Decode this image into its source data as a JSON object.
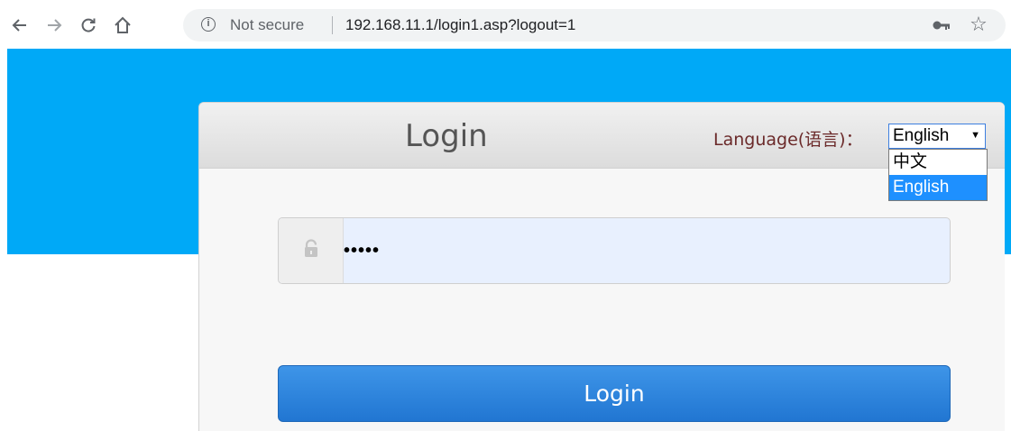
{
  "browser": {
    "security_label": "Not secure",
    "url": "192.168.11.1/login1.asp?logout=1"
  },
  "login_panel": {
    "title": "Login",
    "language_label": "Language(语言)：",
    "language_selected": "English",
    "language_options": [
      "中文",
      "English"
    ],
    "password_masked": "•••••",
    "login_button": "Login"
  },
  "colors": {
    "accent_blue": "#00a9f7",
    "button_blue": "#2a82dc",
    "option_highlight": "#1e90ff"
  },
  "icons": {
    "back": "back-arrow-icon",
    "forward": "forward-arrow-icon",
    "reload": "reload-icon",
    "home": "home-icon",
    "info": "info-icon",
    "key": "key-icon",
    "star": "star-icon",
    "lock": "lock-icon"
  }
}
